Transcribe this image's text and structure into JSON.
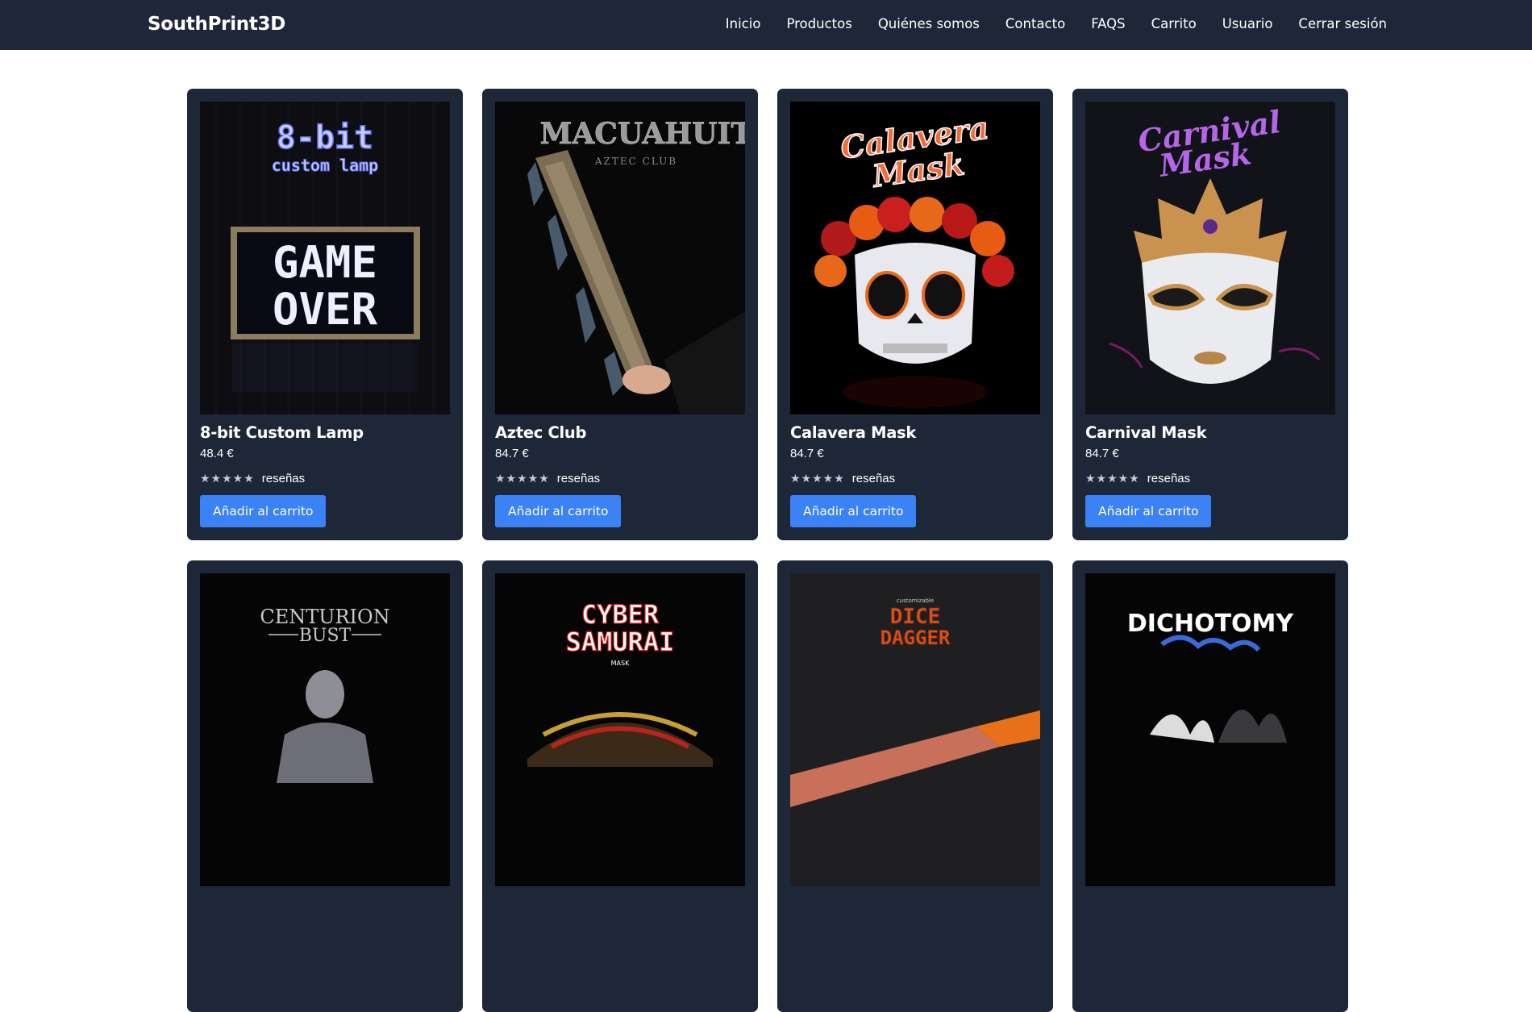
{
  "brand": "SouthPrint3D",
  "nav": [
    "Inicio",
    "Productos",
    "Quiénes somos",
    "Contacto",
    "FAQS",
    "Carrito",
    "Usuario",
    "Cerrar sesión"
  ],
  "colors": {
    "navbar": "#1e2738",
    "card": "#1e2738",
    "button": "#3b82f6"
  },
  "products": [
    {
      "title": "8-bit Custom Lamp",
      "price": "48.4 €",
      "stars": "★★★★★",
      "reviews": "reseñas",
      "button": "Añadir al carrito",
      "image_text": [
        "8-bit",
        "custom lamp",
        "GAME",
        "OVER"
      ]
    },
    {
      "title": "Aztec Club",
      "price": "84.7 €",
      "stars": "★★★★★",
      "reviews": "reseñas",
      "button": "Añadir al carrito",
      "image_text": [
        "MACUAHUITL",
        "AZTEC CLUB"
      ]
    },
    {
      "title": "Calavera Mask",
      "price": "84.7 €",
      "stars": "★★★★★",
      "reviews": "reseñas",
      "button": "Añadir al carrito",
      "image_text": [
        "Calavera",
        "Mask"
      ]
    },
    {
      "title": "Carnival Mask",
      "price": "84.7 €",
      "stars": "★★★★★",
      "reviews": "reseñas",
      "button": "Añadir al carrito",
      "image_text": [
        "Carnival",
        "Mask"
      ]
    },
    {
      "image_text": [
        "CENTURION",
        "BUST"
      ]
    },
    {
      "image_text": [
        "CYBER",
        "SAMURAI",
        "MASK"
      ]
    },
    {
      "image_text": [
        "customizable",
        "DICE",
        "DAGGER"
      ]
    },
    {
      "image_text": [
        "DICHOTOMY"
      ]
    }
  ]
}
